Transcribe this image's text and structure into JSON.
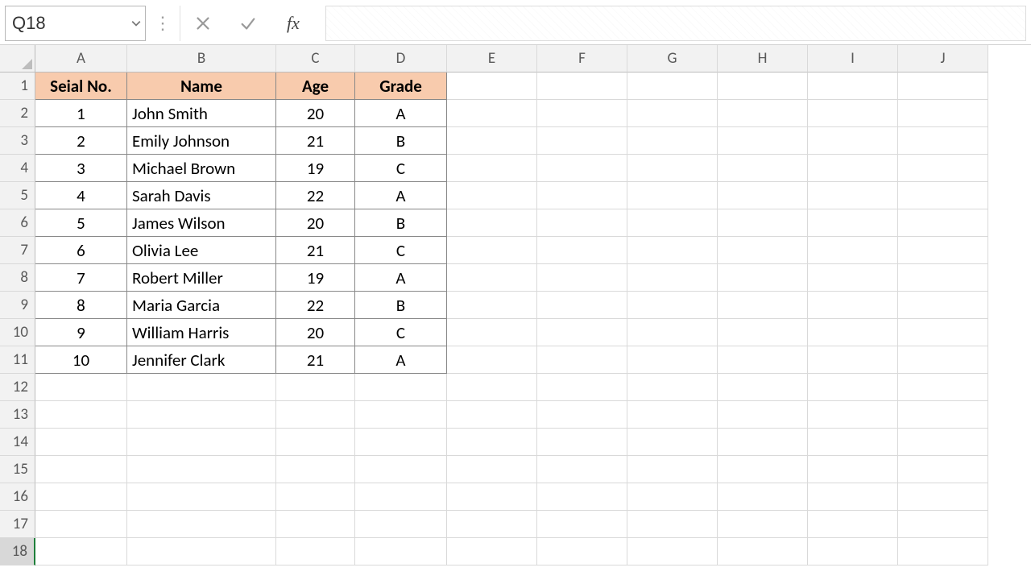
{
  "formula_bar": {
    "name_box_value": "Q18",
    "formula_value": "",
    "fx_label": "fx"
  },
  "columns": [
    "A",
    "B",
    "C",
    "D",
    "E",
    "F",
    "G",
    "H",
    "I",
    "J"
  ],
  "row_count": 18,
  "active_row": 18,
  "table": {
    "headers": {
      "serial": "Seial No.",
      "name": "Name",
      "age": "Age",
      "grade": "Grade"
    },
    "rows": [
      {
        "serial": 1,
        "name": "John Smith",
        "age": 20,
        "grade": "A"
      },
      {
        "serial": 2,
        "name": "Emily Johnson",
        "age": 21,
        "grade": "B"
      },
      {
        "serial": 3,
        "name": "Michael Brown",
        "age": 19,
        "grade": "C"
      },
      {
        "serial": 4,
        "name": "Sarah Davis",
        "age": 22,
        "grade": "A"
      },
      {
        "serial": 5,
        "name": "James Wilson",
        "age": 20,
        "grade": "B"
      },
      {
        "serial": 6,
        "name": "Olivia Lee",
        "age": 21,
        "grade": "C"
      },
      {
        "serial": 7,
        "name": "Robert Miller",
        "age": 19,
        "grade": "A"
      },
      {
        "serial": 8,
        "name": "Maria Garcia",
        "age": 22,
        "grade": "B"
      },
      {
        "serial": 9,
        "name": "William Harris",
        "age": 20,
        "grade": "C"
      },
      {
        "serial": 10,
        "name": "Jennifer Clark",
        "age": 21,
        "grade": "A"
      }
    ]
  }
}
